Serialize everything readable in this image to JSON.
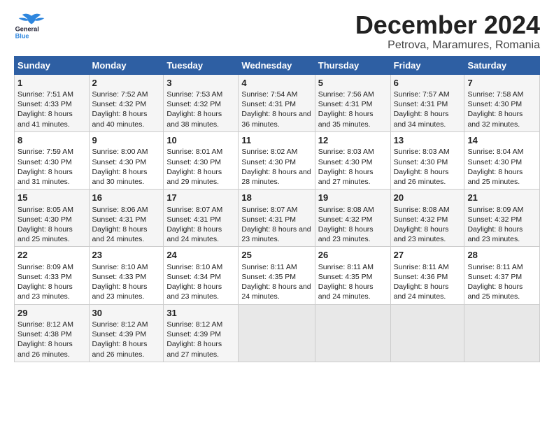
{
  "header": {
    "logo_general": "General",
    "logo_blue": "Blue",
    "title": "December 2024",
    "subtitle": "Petrova, Maramures, Romania"
  },
  "weekdays": [
    "Sunday",
    "Monday",
    "Tuesday",
    "Wednesday",
    "Thursday",
    "Friday",
    "Saturday"
  ],
  "weeks": [
    [
      {
        "day": "1",
        "sunrise": "7:51 AM",
        "sunset": "4:33 PM",
        "daylight": "8 hours and 41 minutes."
      },
      {
        "day": "2",
        "sunrise": "7:52 AM",
        "sunset": "4:32 PM",
        "daylight": "8 hours and 40 minutes."
      },
      {
        "day": "3",
        "sunrise": "7:53 AM",
        "sunset": "4:32 PM",
        "daylight": "8 hours and 38 minutes."
      },
      {
        "day": "4",
        "sunrise": "7:54 AM",
        "sunset": "4:31 PM",
        "daylight": "8 hours and 36 minutes."
      },
      {
        "day": "5",
        "sunrise": "7:56 AM",
        "sunset": "4:31 PM",
        "daylight": "8 hours and 35 minutes."
      },
      {
        "day": "6",
        "sunrise": "7:57 AM",
        "sunset": "4:31 PM",
        "daylight": "8 hours and 34 minutes."
      },
      {
        "day": "7",
        "sunrise": "7:58 AM",
        "sunset": "4:30 PM",
        "daylight": "8 hours and 32 minutes."
      }
    ],
    [
      {
        "day": "8",
        "sunrise": "7:59 AM",
        "sunset": "4:30 PM",
        "daylight": "8 hours and 31 minutes."
      },
      {
        "day": "9",
        "sunrise": "8:00 AM",
        "sunset": "4:30 PM",
        "daylight": "8 hours and 30 minutes."
      },
      {
        "day": "10",
        "sunrise": "8:01 AM",
        "sunset": "4:30 PM",
        "daylight": "8 hours and 29 minutes."
      },
      {
        "day": "11",
        "sunrise": "8:02 AM",
        "sunset": "4:30 PM",
        "daylight": "8 hours and 28 minutes."
      },
      {
        "day": "12",
        "sunrise": "8:03 AM",
        "sunset": "4:30 PM",
        "daylight": "8 hours and 27 minutes."
      },
      {
        "day": "13",
        "sunrise": "8:03 AM",
        "sunset": "4:30 PM",
        "daylight": "8 hours and 26 minutes."
      },
      {
        "day": "14",
        "sunrise": "8:04 AM",
        "sunset": "4:30 PM",
        "daylight": "8 hours and 25 minutes."
      }
    ],
    [
      {
        "day": "15",
        "sunrise": "8:05 AM",
        "sunset": "4:30 PM",
        "daylight": "8 hours and 25 minutes."
      },
      {
        "day": "16",
        "sunrise": "8:06 AM",
        "sunset": "4:31 PM",
        "daylight": "8 hours and 24 minutes."
      },
      {
        "day": "17",
        "sunrise": "8:07 AM",
        "sunset": "4:31 PM",
        "daylight": "8 hours and 24 minutes."
      },
      {
        "day": "18",
        "sunrise": "8:07 AM",
        "sunset": "4:31 PM",
        "daylight": "8 hours and 23 minutes."
      },
      {
        "day": "19",
        "sunrise": "8:08 AM",
        "sunset": "4:32 PM",
        "daylight": "8 hours and 23 minutes."
      },
      {
        "day": "20",
        "sunrise": "8:08 AM",
        "sunset": "4:32 PM",
        "daylight": "8 hours and 23 minutes."
      },
      {
        "day": "21",
        "sunrise": "8:09 AM",
        "sunset": "4:32 PM",
        "daylight": "8 hours and 23 minutes."
      }
    ],
    [
      {
        "day": "22",
        "sunrise": "8:09 AM",
        "sunset": "4:33 PM",
        "daylight": "8 hours and 23 minutes."
      },
      {
        "day": "23",
        "sunrise": "8:10 AM",
        "sunset": "4:33 PM",
        "daylight": "8 hours and 23 minutes."
      },
      {
        "day": "24",
        "sunrise": "8:10 AM",
        "sunset": "4:34 PM",
        "daylight": "8 hours and 23 minutes."
      },
      {
        "day": "25",
        "sunrise": "8:11 AM",
        "sunset": "4:35 PM",
        "daylight": "8 hours and 24 minutes."
      },
      {
        "day": "26",
        "sunrise": "8:11 AM",
        "sunset": "4:35 PM",
        "daylight": "8 hours and 24 minutes."
      },
      {
        "day": "27",
        "sunrise": "8:11 AM",
        "sunset": "4:36 PM",
        "daylight": "8 hours and 24 minutes."
      },
      {
        "day": "28",
        "sunrise": "8:11 AM",
        "sunset": "4:37 PM",
        "daylight": "8 hours and 25 minutes."
      }
    ],
    [
      {
        "day": "29",
        "sunrise": "8:12 AM",
        "sunset": "4:38 PM",
        "daylight": "8 hours and 26 minutes."
      },
      {
        "day": "30",
        "sunrise": "8:12 AM",
        "sunset": "4:39 PM",
        "daylight": "8 hours and 26 minutes."
      },
      {
        "day": "31",
        "sunrise": "8:12 AM",
        "sunset": "4:39 PM",
        "daylight": "8 hours and 27 minutes."
      },
      null,
      null,
      null,
      null
    ]
  ]
}
